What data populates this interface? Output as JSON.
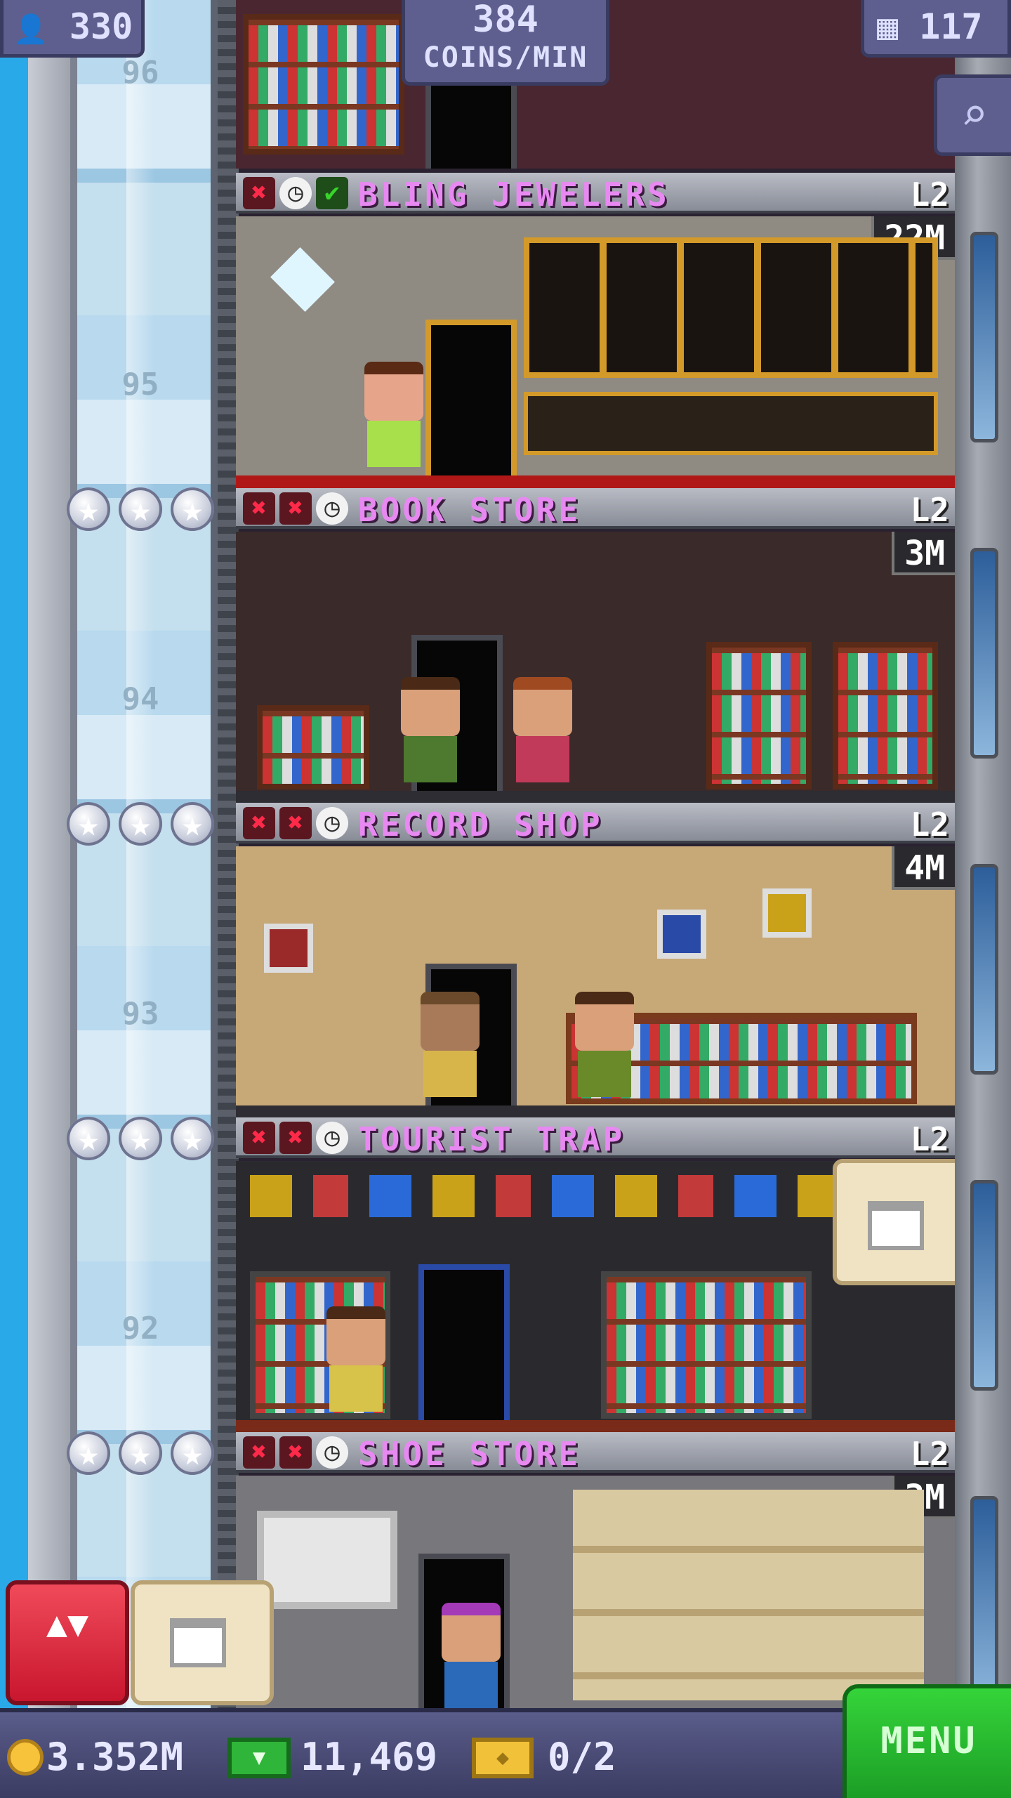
{
  "hud": {
    "population": "330",
    "coins_per_min_value": "384",
    "coins_per_min_unit": "COINS/MIN",
    "floors": "117"
  },
  "shaft_floor_numbers": [
    "96",
    "95",
    "94",
    "93",
    "92"
  ],
  "floors": [
    {
      "name": "BLING JEWELERS",
      "level": "L2",
      "stock": "22M",
      "status": [
        "x",
        "clock",
        "check"
      ],
      "colors": {
        "wall": "#8f8a82",
        "accent": "#e0a32a"
      }
    },
    {
      "name": "BOOK STORE",
      "level": "L2",
      "stock": "3M",
      "status": [
        "x",
        "x",
        "clock"
      ],
      "colors": {
        "wall": "#3a2a2a",
        "accent": "#6b3a22"
      }
    },
    {
      "name": "RECORD SHOP",
      "level": "L2",
      "stock": "4M",
      "status": [
        "x",
        "x",
        "clock"
      ],
      "colors": {
        "wall": "#c7a877",
        "accent": "#7a3a1c"
      }
    },
    {
      "name": "TOURIST TRAP",
      "level": "L2",
      "stock": "",
      "status": [
        "x",
        "x",
        "clock"
      ],
      "colors": {
        "wall": "#2a2a2e",
        "accent": "#2a4aa8"
      }
    },
    {
      "name": "SHOE STORE",
      "level": "L2",
      "stock": "3M",
      "status": [
        "x",
        "x",
        "clock"
      ],
      "colors": {
        "wall": "#77777c",
        "accent": "#d9c9a0"
      }
    }
  ],
  "bottom": {
    "coins": "3.352M",
    "bux": "11,469",
    "tickets": "0/2",
    "menu_label": "MENU"
  },
  "icons": {
    "status_x": "✖",
    "status_clock": "◷",
    "status_check": "✔",
    "star": "★",
    "person": "👤",
    "floors": "▦",
    "search": "⌕",
    "elevator": "▲▼"
  }
}
